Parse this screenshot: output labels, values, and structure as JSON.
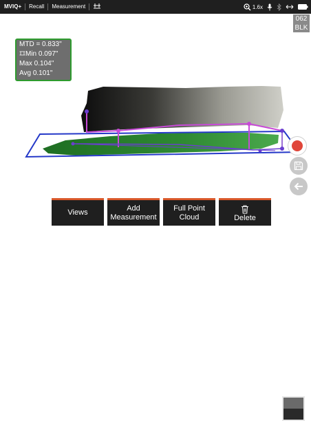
{
  "topbar": {
    "tabs": [
      "MVIQ+",
      "Recall",
      "Measurement"
    ],
    "zoom": "1.6x"
  },
  "corner_code": {
    "line1": "062",
    "line2": "BLK"
  },
  "results": {
    "mtd": "MTD = 0.833\"",
    "min": "Min 0.097\"",
    "max": "Max 0.104\"",
    "avg": "Avg 0.101\""
  },
  "softkeys": {
    "views": "Views",
    "add_line1": "Add",
    "add_line2": "Measurement",
    "cloud_line1": "Full Point",
    "cloud_line2": "Cloud",
    "delete": "Delete"
  },
  "icons": {
    "zoom": "zoom-magnifier-icon",
    "mic": "microphone-icon",
    "bluetooth": "bluetooth-icon",
    "arrows": "horizontal-arrows-icon",
    "battery": "battery-icon",
    "measure": "measurement-tool-icon",
    "record": "record-icon",
    "save": "save-icon",
    "back": "back-arrow-icon",
    "trash": "trash-icon"
  },
  "colors": {
    "measurement_plane": "#2438c8",
    "measurement_line": "#c84ad8",
    "results_border": "#2e9b2e",
    "softkey_accent": "#d8582a",
    "record": "#e0463a"
  }
}
